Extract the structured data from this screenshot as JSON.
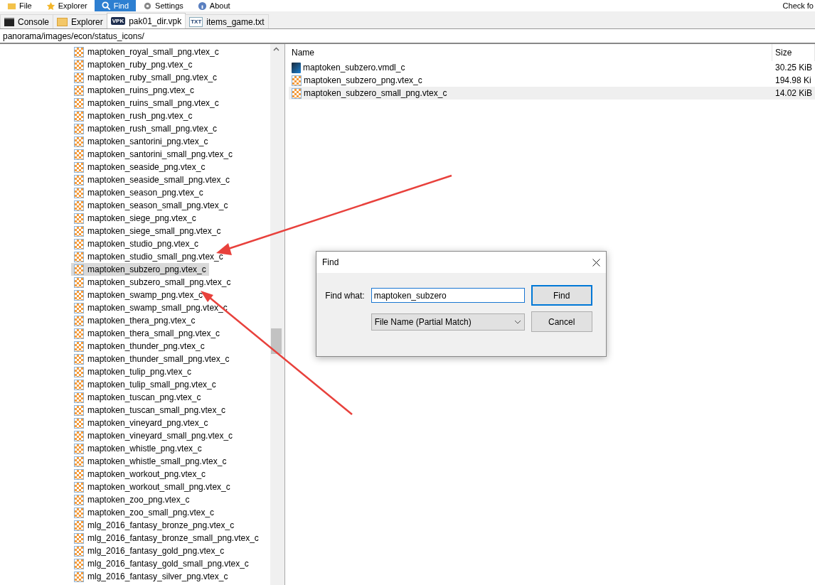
{
  "menu": [
    {
      "label": "File",
      "selected": false
    },
    {
      "label": "Explorer",
      "selected": false
    },
    {
      "label": "Find",
      "selected": true
    },
    {
      "label": "Settings",
      "selected": false
    },
    {
      "label": "About",
      "selected": false
    }
  ],
  "menu_right": "Check fo",
  "tabs": [
    {
      "label": "Console",
      "kind": "console",
      "selected": false
    },
    {
      "label": "Explorer",
      "kind": "explorer",
      "selected": false
    },
    {
      "label": "pak01_dir.vpk",
      "kind": "vpk",
      "icon_text": "VPK",
      "selected": true
    },
    {
      "label": "items_game.txt",
      "kind": "txt",
      "icon_text": "TXT",
      "selected": false
    }
  ],
  "path": "panorama/images/econ/status_icons/",
  "tree": {
    "items": [
      {
        "label": "maptoken_royal_small_png.vtex_c",
        "selected": false
      },
      {
        "label": "maptoken_ruby_png.vtex_c",
        "selected": false
      },
      {
        "label": "maptoken_ruby_small_png.vtex_c",
        "selected": false
      },
      {
        "label": "maptoken_ruins_png.vtex_c",
        "selected": false
      },
      {
        "label": "maptoken_ruins_small_png.vtex_c",
        "selected": false
      },
      {
        "label": "maptoken_rush_png.vtex_c",
        "selected": false
      },
      {
        "label": "maptoken_rush_small_png.vtex_c",
        "selected": false
      },
      {
        "label": "maptoken_santorini_png.vtex_c",
        "selected": false
      },
      {
        "label": "maptoken_santorini_small_png.vtex_c",
        "selected": false
      },
      {
        "label": "maptoken_seaside_png.vtex_c",
        "selected": false
      },
      {
        "label": "maptoken_seaside_small_png.vtex_c",
        "selected": false
      },
      {
        "label": "maptoken_season_png.vtex_c",
        "selected": false
      },
      {
        "label": "maptoken_season_small_png.vtex_c",
        "selected": false
      },
      {
        "label": "maptoken_siege_png.vtex_c",
        "selected": false
      },
      {
        "label": "maptoken_siege_small_png.vtex_c",
        "selected": false
      },
      {
        "label": "maptoken_studio_png.vtex_c",
        "selected": false
      },
      {
        "label": "maptoken_studio_small_png.vtex_c",
        "selected": false
      },
      {
        "label": "maptoken_subzero_png.vtex_c",
        "selected": true
      },
      {
        "label": "maptoken_subzero_small_png.vtex_c",
        "selected": false
      },
      {
        "label": "maptoken_swamp_png.vtex_c",
        "selected": false
      },
      {
        "label": "maptoken_swamp_small_png.vtex_c",
        "selected": false
      },
      {
        "label": "maptoken_thera_png.vtex_c",
        "selected": false
      },
      {
        "label": "maptoken_thera_small_png.vtex_c",
        "selected": false
      },
      {
        "label": "maptoken_thunder_png.vtex_c",
        "selected": false
      },
      {
        "label": "maptoken_thunder_small_png.vtex_c",
        "selected": false
      },
      {
        "label": "maptoken_tulip_png.vtex_c",
        "selected": false
      },
      {
        "label": "maptoken_tulip_small_png.vtex_c",
        "selected": false
      },
      {
        "label": "maptoken_tuscan_png.vtex_c",
        "selected": false
      },
      {
        "label": "maptoken_tuscan_small_png.vtex_c",
        "selected": false
      },
      {
        "label": "maptoken_vineyard_png.vtex_c",
        "selected": false
      },
      {
        "label": "maptoken_vineyard_small_png.vtex_c",
        "selected": false
      },
      {
        "label": "maptoken_whistle_png.vtex_c",
        "selected": false
      },
      {
        "label": "maptoken_whistle_small_png.vtex_c",
        "selected": false
      },
      {
        "label": "maptoken_workout_png.vtex_c",
        "selected": false
      },
      {
        "label": "maptoken_workout_small_png.vtex_c",
        "selected": false
      },
      {
        "label": "maptoken_zoo_png.vtex_c",
        "selected": false
      },
      {
        "label": "maptoken_zoo_small_png.vtex_c",
        "selected": false
      },
      {
        "label": "mlg_2016_fantasy_bronze_png.vtex_c",
        "selected": false
      },
      {
        "label": "mlg_2016_fantasy_bronze_small_png.vtex_c",
        "selected": false
      },
      {
        "label": "mlg_2016_fantasy_gold_png.vtex_c",
        "selected": false
      },
      {
        "label": "mlg_2016_fantasy_gold_small_png.vtex_c",
        "selected": false
      },
      {
        "label": "mlg_2016_fantasy_silver_png.vtex_c",
        "selected": false
      }
    ]
  },
  "files": {
    "columns": [
      "Name",
      "Size"
    ],
    "rows": [
      {
        "name": "maptoken_subzero.vmdl_c",
        "size": "30.25 KiB",
        "kind": "model",
        "selected": false
      },
      {
        "name": "maptoken_subzero_png.vtex_c",
        "size": "194.98 Ki",
        "kind": "texture",
        "selected": false
      },
      {
        "name": "maptoken_subzero_small_png.vtex_c",
        "size": "14.02 KiB",
        "kind": "texture",
        "selected": true
      }
    ]
  },
  "dialog": {
    "title": "Find",
    "label": "Find what:",
    "value": "maptoken_subzero",
    "mode": "File Name (Partial Match)",
    "buttons": [
      {
        "label": "Find",
        "default": true
      },
      {
        "label": "Cancel",
        "default": false
      }
    ]
  }
}
